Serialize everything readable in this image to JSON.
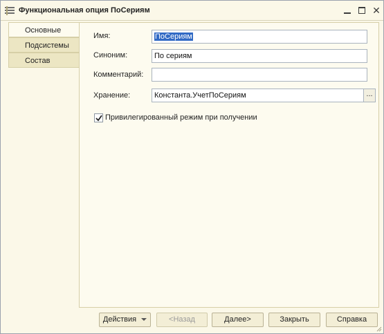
{
  "window": {
    "title": "Функциональная опция ПоСериям",
    "minimize_icon": "minimize-icon",
    "maximize_icon": "maximize-icon",
    "close_glyph": "✕"
  },
  "tabs": [
    {
      "label": "Основные",
      "active": true
    },
    {
      "label": "Подсистемы",
      "active": false
    },
    {
      "label": "Состав",
      "active": false
    }
  ],
  "form": {
    "name_label": "Имя:",
    "name_value": "ПоСериям",
    "synonym_label": "Синоним:",
    "synonym_value": "По сериям",
    "comment_label": "Комментарий:",
    "comment_value": "",
    "storage_label": "Хранение:",
    "storage_value": "Константа.УчетПоСериям",
    "storage_choose": "...",
    "privileged_label": "Привилегированный режим при получении",
    "privileged_checked": true
  },
  "buttons": {
    "actions": "Действия",
    "back": "<Назад",
    "next": "Далее>",
    "close": "Закрыть",
    "help": "Справка"
  },
  "colors": {
    "window_bg": "#fbf8e8",
    "selection": "#316ac5"
  }
}
